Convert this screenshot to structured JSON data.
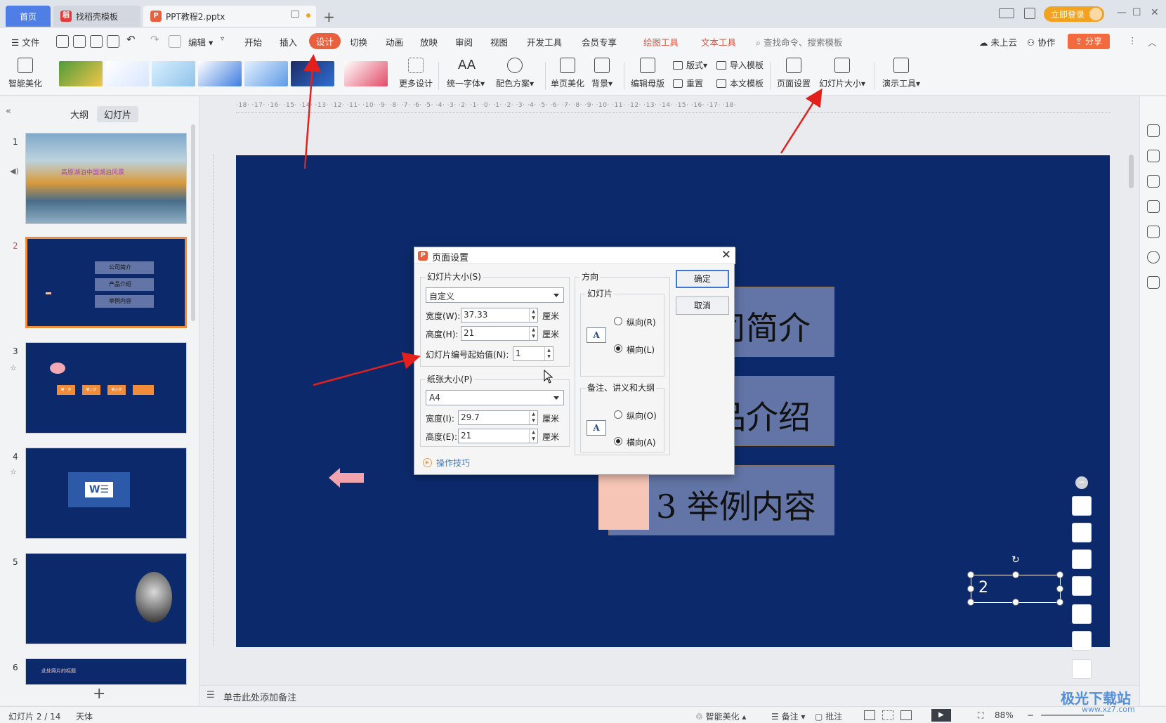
{
  "tabs": {
    "home": "首页",
    "template": "找稻壳模板",
    "doc": "PPT教程2.pptx"
  },
  "login": "立即登录",
  "menu": {
    "file": "文件",
    "edit": "编辑",
    "start": "开始",
    "insert": "插入",
    "design": "设计",
    "transition": "切换",
    "animation": "动画",
    "slideshow": "放映",
    "review": "审阅",
    "view": "视图",
    "devtools": "开发工具",
    "member": "会员专享",
    "drawtools": "绘图工具",
    "texttools": "文本工具",
    "search": "查找命令、搜索模板",
    "cloud": "未上云",
    "collab": "协作",
    "share": "分享"
  },
  "ribbon": {
    "smart": "智能美化",
    "more_design": "更多设计",
    "unify_font": "统一字体",
    "color_scheme": "配色方案",
    "single_page": "单页美化",
    "background": "背景",
    "edit_master": "编辑母版",
    "layout": "版式",
    "reset": "重置",
    "import_tpl": "导入模板",
    "this_tpl": "本文模板",
    "page_setup": "页面设置",
    "slide_size": "幻灯片大小",
    "present_tools": "演示工具"
  },
  "left_panel": {
    "tab_outline": "大纲",
    "tab_slides": "幻灯片",
    "slide_numbers": [
      "1",
      "2",
      "3",
      "4",
      "5",
      "6"
    ],
    "thumb1_title": "高原湖泊中国湖泊风景",
    "thumb2_items": [
      "公司简介",
      "产品介绍",
      "举例内容"
    ],
    "thumb3_steps": [
      "第一步",
      "第二步",
      "第三步"
    ],
    "thumb6_title": "此处照片的标题"
  },
  "slide": {
    "item1": "司简介",
    "item2": "品介绍",
    "item3": "3 举例内容",
    "page_number": "2"
  },
  "ruler": "·18·  ·17·  ·16·  ·15·  ·14·  ·13·  ·12·  ·11·  ·10·  ·9·  ·8·  ·7·  ·6·  ·5·  ·4·  ·3·  ·2·  ·1·  ·0·  ·1·  ·2·  ·3·  ·4·  ·5·  ·6·  ·7·  ·8·  ·9·  ·10·  ·11·  ·12·  ·13·  ·14·  ·15·  ·16·  ·17·  ·18·",
  "dialog": {
    "title": "页面设置",
    "slide_size_group": "幻灯片大小(S)",
    "slide_size_value": "自定义",
    "width_label": "宽度(W):",
    "width_value": "37.33",
    "height_label": "高度(H):",
    "height_value": "21",
    "unit": "厘米",
    "start_num_label": "幻灯片编号起始值(N):",
    "start_num_value": "1",
    "paper_group": "纸张大小(P)",
    "paper_value": "A4",
    "paper_width_label": "宽度(I):",
    "paper_width_value": "29.7",
    "paper_height_label": "高度(E):",
    "paper_height_value": "21",
    "direction_group": "方向",
    "slide_dir_group": "幻灯片",
    "portrait_r": "纵向(R)",
    "landscape_l": "横向(L)",
    "notes_group": "备注、讲义和大纲",
    "portrait_o": "纵向(O)",
    "landscape_a": "横向(A)",
    "ok": "确定",
    "cancel": "取消",
    "tips": "操作技巧"
  },
  "notes_placeholder": "单击此处添加备注",
  "status": {
    "slide_count": "幻灯片 2 / 14",
    "theme": "天体",
    "smart": "智能美化",
    "notes": "备注",
    "comment": "批注",
    "zoom": "88%"
  },
  "watermark": "极光下载站",
  "watermark_url": "www.xz7.com",
  "colors": {
    "accent": "#e9603f",
    "slide_bg": "#0c2a6b",
    "item_box": "#6275a6",
    "item_square": "#f6c5b5",
    "annotation": "#e3201b"
  }
}
